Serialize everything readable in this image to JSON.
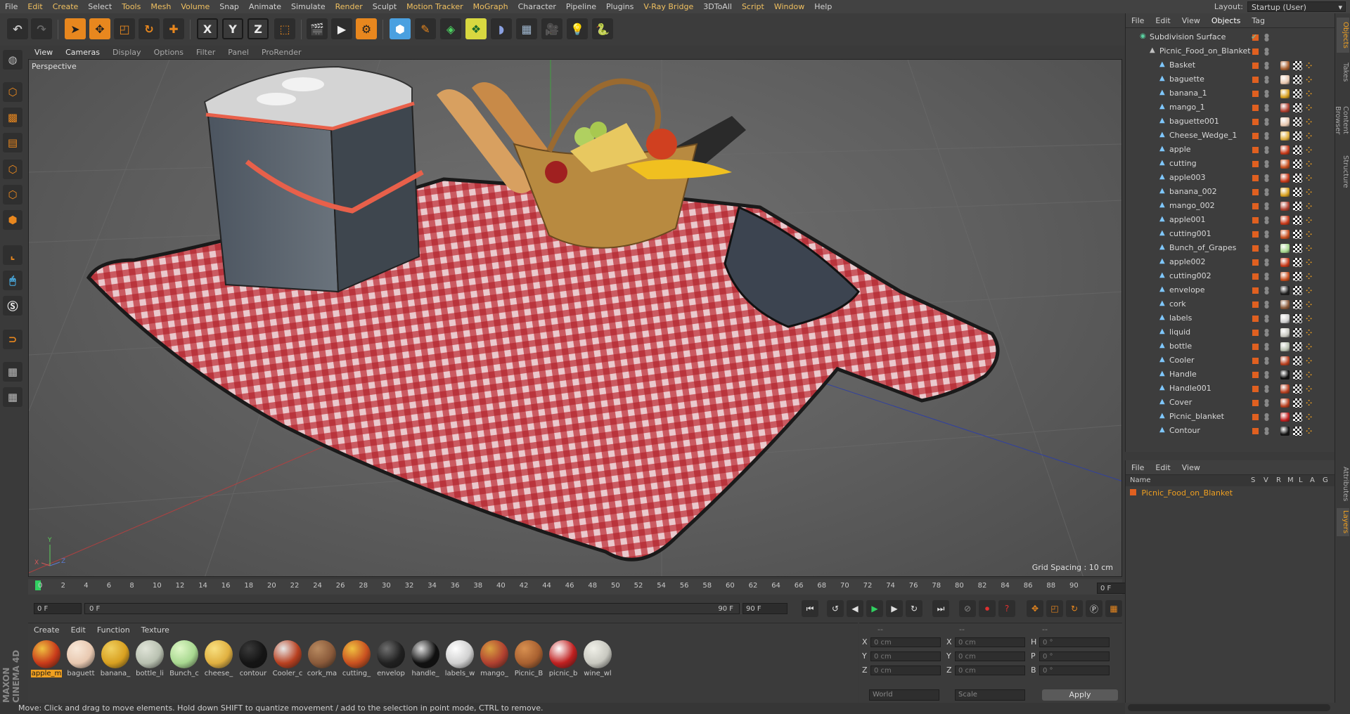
{
  "menubar": {
    "items": [
      {
        "label": "File",
        "hl": false
      },
      {
        "label": "Edit",
        "hl": true
      },
      {
        "label": "Create",
        "hl": true
      },
      {
        "label": "Select",
        "hl": false
      },
      {
        "label": "Tools",
        "hl": true
      },
      {
        "label": "Mesh",
        "hl": true
      },
      {
        "label": "Volume",
        "hl": true
      },
      {
        "label": "Snap",
        "hl": false
      },
      {
        "label": "Animate",
        "hl": false
      },
      {
        "label": "Simulate",
        "hl": false
      },
      {
        "label": "Render",
        "hl": true
      },
      {
        "label": "Sculpt",
        "hl": false
      },
      {
        "label": "Motion Tracker",
        "hl": true
      },
      {
        "label": "MoGraph",
        "hl": true
      },
      {
        "label": "Character",
        "hl": false
      },
      {
        "label": "Pipeline",
        "hl": false
      },
      {
        "label": "Plugins",
        "hl": false
      },
      {
        "label": "V-Ray Bridge",
        "hl": true
      },
      {
        "label": "3DToAll",
        "hl": false
      },
      {
        "label": "Script",
        "hl": true
      },
      {
        "label": "Window",
        "hl": true
      },
      {
        "label": "Help",
        "hl": false
      }
    ],
    "layout_label": "Layout:",
    "layout_value": "Startup (User)"
  },
  "toolbar": {
    "x_axis": "X",
    "y_axis": "Y",
    "z_axis": "Z"
  },
  "viewport_menu": [
    "View",
    "Cameras",
    "Display",
    "Options",
    "Filter",
    "Panel",
    "ProRender"
  ],
  "viewport": {
    "label": "Perspective",
    "grid_spacing": "Grid Spacing : 10 cm"
  },
  "timeline": {
    "ticks": [
      "0",
      "2",
      "4",
      "6",
      "8",
      "10",
      "12",
      "14",
      "16",
      "18",
      "20",
      "22",
      "24",
      "26",
      "28",
      "30",
      "32",
      "34",
      "36",
      "38",
      "40",
      "42",
      "44",
      "46",
      "48",
      "50",
      "52",
      "54",
      "56",
      "58",
      "60",
      "62",
      "64",
      "66",
      "68",
      "70",
      "72",
      "74",
      "76",
      "78",
      "80",
      "82",
      "84",
      "86",
      "88",
      "90"
    ],
    "current_frame": "0 F",
    "start_field": "0 F",
    "range_start": "0 F",
    "range_end": "90 F",
    "end_field": "90 F"
  },
  "materials": {
    "menu": [
      "Create",
      "Edit",
      "Function",
      "Texture"
    ],
    "items": [
      {
        "label": "apple_m",
        "color": "#c83a1a",
        "hi": "#f0c040",
        "selected": true
      },
      {
        "label": "baguett",
        "color": "#e8c8b0",
        "hi": "#f8e8d8",
        "selected": false
      },
      {
        "label": "banana_",
        "color": "#d8a020",
        "hi": "#f0d060",
        "selected": false
      },
      {
        "label": "bottle_li",
        "color": "#b8c0b0",
        "hi": "#e0e4d8",
        "selected": false
      },
      {
        "label": "Bunch_c",
        "color": "#a8d890",
        "hi": "#e0f8c8",
        "selected": false
      },
      {
        "label": "cheese_",
        "color": "#e0b040",
        "hi": "#f8e080",
        "selected": false
      },
      {
        "label": "contour",
        "color": "#141414",
        "hi": "#3a3a3a",
        "selected": false
      },
      {
        "label": "Cooler_c",
        "color": "#b84020",
        "hi": "#e8e8e8",
        "selected": false
      },
      {
        "label": "cork_ma",
        "color": "#8a5a3a",
        "hi": "#b88a60",
        "selected": false
      },
      {
        "label": "cutting_",
        "color": "#c85020",
        "hi": "#f0c040",
        "selected": false
      },
      {
        "label": "envelop",
        "color": "#202020",
        "hi": "#707070",
        "selected": false
      },
      {
        "label": "handle_",
        "color": "#101010",
        "hi": "#e0e0e0",
        "selected": false
      },
      {
        "label": "labels_w",
        "color": "#d0d0d0",
        "hi": "#ffffff",
        "selected": false
      },
      {
        "label": "mango_",
        "color": "#b04030",
        "hi": "#d8a040",
        "selected": false
      },
      {
        "label": "Picnic_B",
        "color": "#a86030",
        "hi": "#d89050",
        "selected": false
      },
      {
        "label": "picnic_b",
        "color": "#c02020",
        "hi": "#ffffff",
        "selected": false
      },
      {
        "label": "wine_wl",
        "color": "#c8c8c0",
        "hi": "#f0f0e8",
        "selected": false
      }
    ]
  },
  "coords": {
    "col_headers": [
      "--",
      "--",
      "--"
    ],
    "rows": [
      {
        "a": "X",
        "av": "0 cm",
        "b": "X",
        "bv": "0 cm",
        "c": "H",
        "cv": "0 °"
      },
      {
        "a": "Y",
        "av": "0 cm",
        "b": "Y",
        "bv": "0 cm",
        "c": "P",
        "cv": "0 °"
      },
      {
        "a": "Z",
        "av": "0 cm",
        "b": "Z",
        "bv": "0 cm",
        "c": "B",
        "cv": "0 °"
      }
    ],
    "mode1": "World",
    "mode2": "Scale",
    "apply": "Apply"
  },
  "status": "Move: Click and drag to move elements. Hold down SHIFT to quantize movement / add to the selection in point mode, CTRL to remove.",
  "objects": {
    "menu": [
      "File",
      "Edit",
      "View",
      "Objects",
      "Tag"
    ],
    "root": "Subdivision Surface",
    "group": "Picnic_Food_on_Blanket",
    "children": [
      {
        "name": "Basket",
        "tag": "#a86030"
      },
      {
        "name": "baguette",
        "tag": "#e8c8b0"
      },
      {
        "name": "banana_1",
        "tag": "#d8a020"
      },
      {
        "name": "mango_1",
        "tag": "#b04030"
      },
      {
        "name": "baguette001",
        "tag": "#e8c8b0"
      },
      {
        "name": "Cheese_Wedge_1",
        "tag": "#e0b040"
      },
      {
        "name": "apple",
        "tag": "#c83a1a"
      },
      {
        "name": "cutting",
        "tag": "#c85020"
      },
      {
        "name": "apple003",
        "tag": "#c83a1a"
      },
      {
        "name": "banana_002",
        "tag": "#d8a020"
      },
      {
        "name": "mango_002",
        "tag": "#b04030"
      },
      {
        "name": "apple001",
        "tag": "#c83a1a"
      },
      {
        "name": "cutting001",
        "tag": "#c85020"
      },
      {
        "name": "Bunch_of_Grapes",
        "tag": "#a8d890"
      },
      {
        "name": "apple002",
        "tag": "#c83a1a"
      },
      {
        "name": "cutting002",
        "tag": "#c85020"
      },
      {
        "name": "envelope",
        "tag": "#202020"
      },
      {
        "name": "cork",
        "tag": "#8a5a3a"
      },
      {
        "name": "labels",
        "tag": "#d0d0d0"
      },
      {
        "name": "liquid",
        "tag": "#c8c8c0"
      },
      {
        "name": "bottle",
        "tag": "#b8c0b0"
      },
      {
        "name": "Cooler",
        "tag": "#b84020"
      },
      {
        "name": "Handle",
        "tag": "#101010"
      },
      {
        "name": "Handle001",
        "tag": "#b84020"
      },
      {
        "name": "Cover",
        "tag": "#b84020"
      },
      {
        "name": "Picnic_blanket",
        "tag": "#c02020"
      },
      {
        "name": "Contour",
        "tag": "#141414"
      }
    ]
  },
  "layers": {
    "menu": [
      "File",
      "Edit",
      "View"
    ],
    "headers": [
      "Name",
      "S",
      "V",
      "R",
      "M",
      "L",
      "A",
      "G"
    ],
    "row": "Picnic_Food_on_Blanket"
  },
  "side_tabs": [
    "Objects",
    "Takes",
    "Content Browser",
    "Structure",
    "Attributes",
    "Layers"
  ],
  "colors": {
    "accent": "#e8871e",
    "menu_highlight": "#f0c060",
    "layer_row": "#f0a020"
  }
}
